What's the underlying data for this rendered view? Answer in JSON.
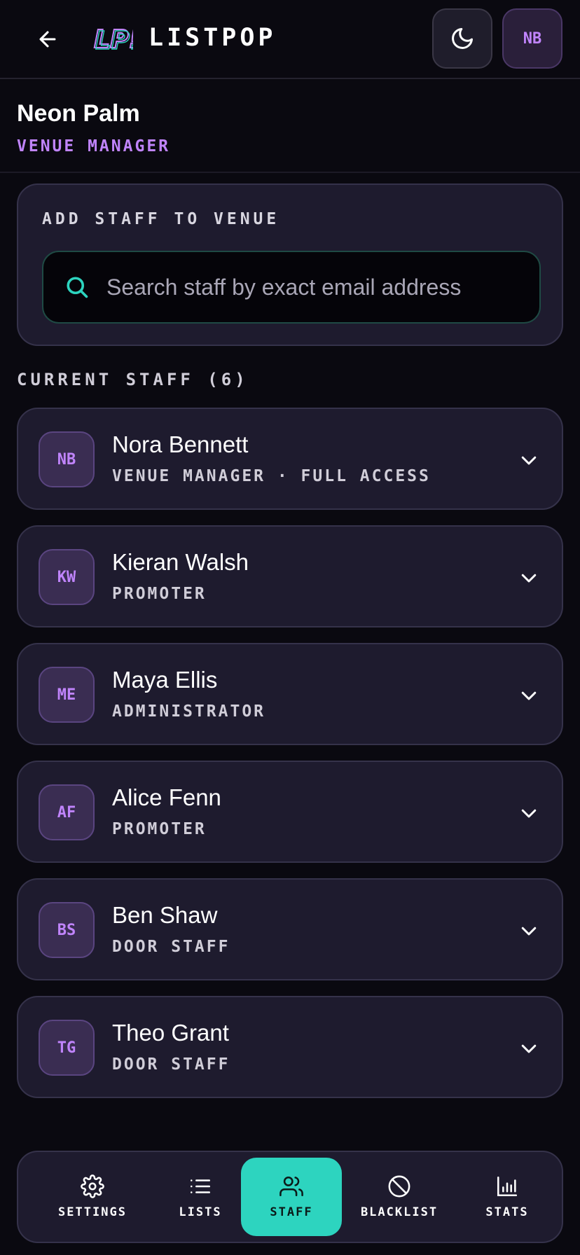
{
  "header": {
    "app_title": "LISTPOP",
    "avatar_initials": "NB",
    "logo_text": "LP!"
  },
  "venue": {
    "name": "Neon Palm",
    "role": "VENUE MANAGER"
  },
  "add_staff": {
    "title": "ADD STAFF TO VENUE",
    "search_placeholder": "Search staff by exact email address",
    "search_value": ""
  },
  "staff_section": {
    "label": "CURRENT STAFF (6)"
  },
  "staff": [
    {
      "initials": "NB",
      "name": "Nora Bennett",
      "role": "VENUE MANAGER · FULL ACCESS"
    },
    {
      "initials": "KW",
      "name": "Kieran Walsh",
      "role": "PROMOTER"
    },
    {
      "initials": "ME",
      "name": "Maya Ellis",
      "role": "ADMINISTRATOR"
    },
    {
      "initials": "AF",
      "name": "Alice Fenn",
      "role": "PROMOTER"
    },
    {
      "initials": "BS",
      "name": "Ben Shaw",
      "role": "DOOR STAFF"
    },
    {
      "initials": "TG",
      "name": "Theo Grant",
      "role": "DOOR STAFF"
    }
  ],
  "nav": {
    "items": [
      {
        "label": "SETTINGS",
        "icon": "gear-icon"
      },
      {
        "label": "LISTS",
        "icon": "list-icon"
      },
      {
        "label": "STAFF",
        "icon": "users-icon",
        "active": true
      },
      {
        "label": "BLACKLIST",
        "icon": "ban-icon"
      },
      {
        "label": "STATS",
        "icon": "bar-chart-icon"
      }
    ]
  },
  "colors": {
    "accent_teal": "#2dd4bf",
    "accent_purple": "#c084fc",
    "background": "#0a0910",
    "card": "#1e1b2e"
  }
}
